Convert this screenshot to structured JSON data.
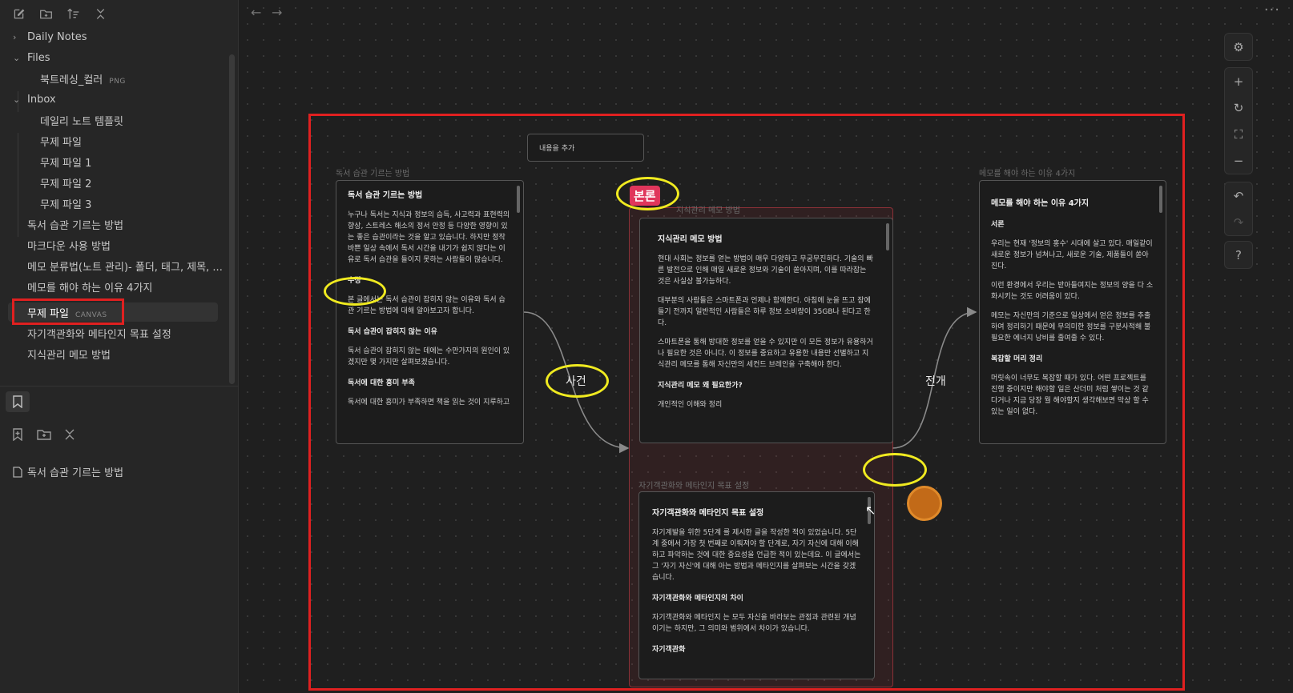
{
  "sidebar": {
    "tree": [
      {
        "label": "Daily Notes",
        "type": "folder",
        "expanded": false
      },
      {
        "label": "Files",
        "type": "folder",
        "expanded": true
      },
      {
        "label": "북트레싱_컬러",
        "type": "file",
        "ext": "PNG"
      },
      {
        "label": "Inbox",
        "type": "folder",
        "expanded": true
      },
      {
        "label": "데일리 노트 템플릿",
        "type": "file"
      },
      {
        "label": "무제 파일",
        "type": "file"
      },
      {
        "label": "무제 파일 1",
        "type": "file"
      },
      {
        "label": "무제 파일 2",
        "type": "file"
      },
      {
        "label": "무제 파일 3",
        "type": "file"
      },
      {
        "label": "독서 습관 기르는 방법",
        "type": "file"
      },
      {
        "label": "마크다운 사용 방법",
        "type": "file"
      },
      {
        "label": "메모 분류법(노트 관리)- 폴더, 태그, 제목, ...",
        "type": "file"
      },
      {
        "label": "메모를 해야 하는 이유 4가지",
        "type": "file"
      },
      {
        "label": "무제 파일",
        "type": "file",
        "ext": "CANVAS",
        "active": true
      },
      {
        "label": "자기객관화와 메타인지 목표 설정",
        "type": "file"
      },
      {
        "label": "지식관리 메모 방법",
        "type": "file"
      }
    ],
    "bookmark_item": "독서 습관 기르는 방법"
  },
  "canvas": {
    "text_node": "내용을 추가",
    "annotations": {
      "main": "본론",
      "event": "사건",
      "development": "전개",
      "edit": "수정"
    },
    "group_label": "지식관리 메모 방법",
    "cards": {
      "reading": {
        "label": "독서 습관 기르는 방법",
        "title": "독서 습관 기르는 방법",
        "p1": "누구나 독서는 지식과 정보의 습득, 사고력과 표현력의 향상, 스트레스 해소의 정서 안정 등 다양한 영향이 있는 좋은 습관이라는 것을 알고 있습니다. 하지만 정작 바쁜 일상 속에서 독서 시간을 내기가 쉽지 않다는 이유로 독서 습관을 들이지 못하는 사람들이 많습니다.",
        "h_edit": "수정",
        "p2": "본 글에서는 독서 습관이 잡히지 않는 이유와 독서 습관 기르는 방법에 대해 알아보고자 합니다.",
        "h2": "독서 습관이 잡히지 않는 이유",
        "p3": "독서 습관이 잡히지 않는 데에는 수만가지의 원인이 있겠지만 몇 가지만 살펴보겠습니다.",
        "h3": "독서에 대한 흥미 부족",
        "p4": "독서에 대한 흥미가 부족하면 책을 읽는 것이 지루하고"
      },
      "knowledge": {
        "title": "지식관리 메모 방법",
        "p1": "현대 사회는 정보를 얻는 방법이 매우 다양하고 무궁무진하다. 기술의 빠른 발전으로 인해 매일 새로운 정보와 기술이 쏟아지며, 이를 따라잡는 것은 사실상 불가능하다.",
        "p2": "대부분의 사람들은 스마트폰과 언제나 함께한다. 아침에 눈을 뜨고 잠에 들기 전까지 일반적인 사람들은 하루 정보 소비량이 35GB나 된다고 한다.",
        "p3": "스마트폰을 통해 방대한 정보를 얻을 수 있지만 이 모든 정보가 유용하거나 필요한 것은 아니다. 이 정보를 중요하고 유용한 내용만 선별하고 지식관리 메모를 통해 자신만의 세컨드 브레인을 구축해야 한다.",
        "h2": "지식관리 메모 왜 필요한가?",
        "p4": "개인적인 이해와 정리"
      },
      "metacog": {
        "label": "자기객관화와 메타인지 목표 설정",
        "title": "자기객관화와 메타인지 목표 설정",
        "p1": "자기계발을 위한 5단계 를 제시한 글을 작성한 적이 있었습니다. 5단계 중에서 가장 첫 번째로 이뤄져야 할 단계로, 자기 자신에 대해 이해하고 파악하는 것에 대한 중요성을 언급한 적이 있는데요. 이 글에서는 그 '자기 자신'에 대해 아는 방법과 메타인지를 살펴보는 시간을 갖겠습니다.",
        "h2": "자기객관화와 메타인지의 차이",
        "p2": "자기객관화와 메타인지 는 모두 자신을 바라보는 관점과 관련된 개념이기는 하지만, 그 의미와 범위에서 차이가 있습니다.",
        "h3": "자기객관화"
      },
      "memo": {
        "label": "메모를 해야 하는 이유 4가지",
        "title": "메모를 해야 하는 이유 4가지",
        "h1": "서론",
        "p1": "우리는 현재 '정보의 홍수' 시대에 살고 있다. 매일같이 새로운 정보가 넘쳐나고, 새로운 기술, 제품들이 쏟아진다.",
        "p2": "이런 환경에서 우리는 받아들여지는 정보의 양을 다 소화시키는 것도 어려움이 있다.",
        "p3": "메모는 자신만의 기준으로 일상에서 얻은 정보를 추출하여 정리하기 때문에 무의미한 정보를 구분사적해 불필요한 에너지 낭비를 줄여줄 수 있다.",
        "h2": "복잡할 머리 정리",
        "p4": "머릿속이 너무도 복잡할 때가 있다. 어떤 프로젝트를 진행 중이지만 해야할 일은 산더미 처럼 쌓이는 것 같다거나 지금 당장 뭘 해야할지 생각해보면 막상 할 수 있는 일이 없다."
      }
    }
  },
  "colors": {
    "highlight_red": "#e02020",
    "highlight_yellow": "#f0ea20",
    "badge_pink": "#e0365b",
    "cursor_orange": "#c26a18"
  }
}
